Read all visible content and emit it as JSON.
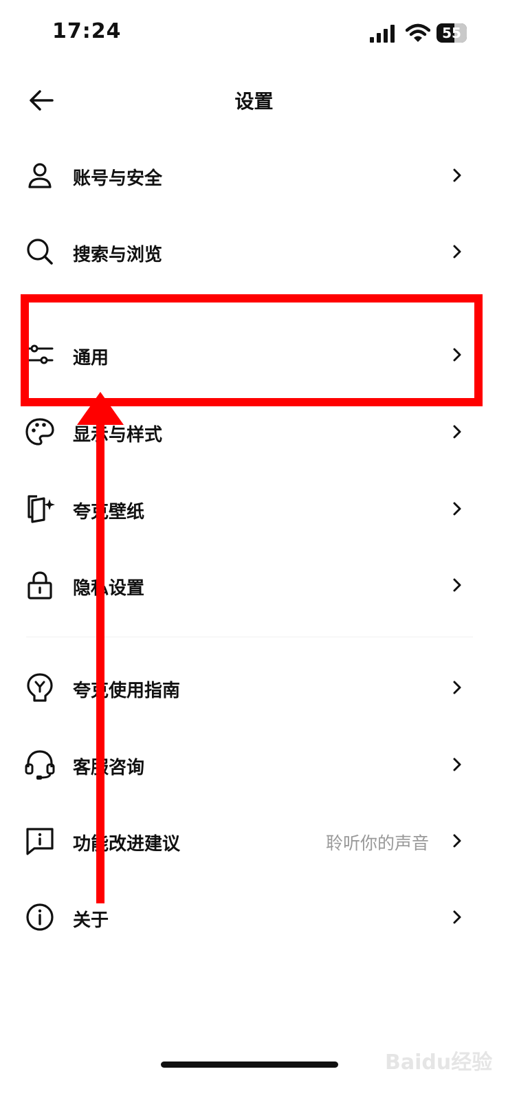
{
  "status_bar": {
    "time": "17:24",
    "battery": "55"
  },
  "header": {
    "title": "设置"
  },
  "menu": {
    "items": [
      {
        "label": "账号与安全",
        "icon": "user-icon",
        "hint": ""
      },
      {
        "label": "搜索与浏览",
        "icon": "search-icon",
        "hint": ""
      },
      {
        "label": "通用",
        "icon": "sliders-icon",
        "hint": ""
      },
      {
        "label": "显示与样式",
        "icon": "palette-icon",
        "hint": ""
      },
      {
        "label": "夸克壁纸",
        "icon": "wallpaper-icon",
        "hint": ""
      },
      {
        "label": "隐私设置",
        "icon": "lock-icon",
        "hint": ""
      },
      {
        "label": "夸克使用指南",
        "icon": "guide-bulb-icon",
        "hint": ""
      },
      {
        "label": "客服咨询",
        "icon": "headset-icon",
        "hint": ""
      },
      {
        "label": "功能改进建议",
        "icon": "feedback-icon",
        "hint": "聆听你的声音"
      },
      {
        "label": "关于",
        "icon": "info-icon",
        "hint": ""
      }
    ]
  },
  "annotation": {
    "highlight_color": "#ff0000"
  },
  "watermark": "Baidu经验"
}
